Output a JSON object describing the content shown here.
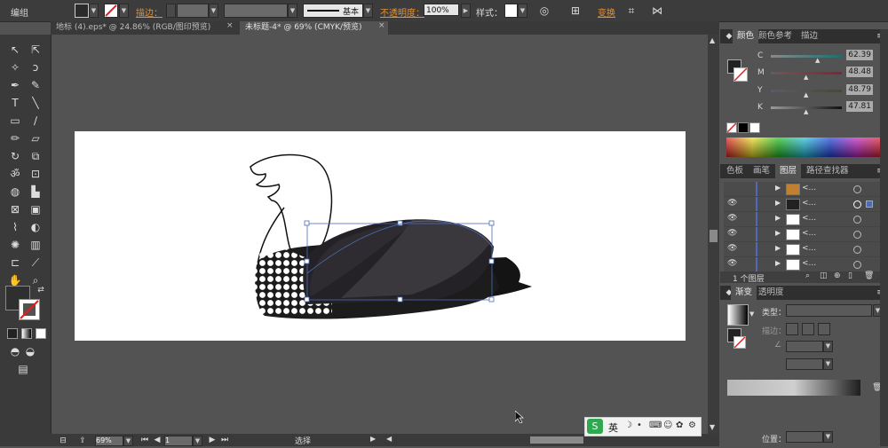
{
  "control_bar": {
    "mode_label": "编组",
    "stroke_label": "描边：",
    "brush_label": "基本",
    "opacity_label": "不透明度：",
    "opacity_value": "100%",
    "style_label": "样式：",
    "transform_label": "变换"
  },
  "tabs": [
    {
      "label": "地标 (4).eps* @ 24.86% (RGB/图印预览)",
      "close": "×"
    },
    {
      "label": "未标题-4* @ 69% (CMYK/预览)",
      "close": "×"
    }
  ],
  "color_panel": {
    "tabs": [
      "颜色",
      "颜色参考",
      "描边"
    ],
    "channels": [
      {
        "name": "C",
        "value": "62.39",
        "pos": 0.62
      },
      {
        "name": "M",
        "value": "48.48",
        "pos": 0.48
      },
      {
        "name": "Y",
        "value": "48.79",
        "pos": 0.49
      },
      {
        "name": "K",
        "value": "47.81",
        "pos": 0.48
      }
    ]
  },
  "layers_panel": {
    "tabs": [
      "色板",
      "画笔",
      "图层",
      "路径查找器"
    ],
    "rows": [
      {
        "name": "<...",
        "eye": ""
      },
      {
        "name": "<...",
        "eye": "👁"
      },
      {
        "name": "<...",
        "eye": "👁"
      },
      {
        "name": "<...",
        "eye": "👁"
      },
      {
        "name": "<...",
        "eye": "👁"
      },
      {
        "name": "<...",
        "eye": "👁"
      }
    ],
    "footer": "1 个图层"
  },
  "gradient_panel": {
    "tabs": [
      "渐变",
      "透明度"
    ],
    "type_label": "类型：",
    "stroke_label": "描边：",
    "position_label": "位置："
  },
  "status_bar": {
    "zoom": "69%",
    "page": "1",
    "mode": "选择"
  },
  "ime": {
    "lang": "英"
  },
  "colors": {
    "ui_dark": "#3c3c3c",
    "ui_mid": "#535353",
    "accent": "#e8902f",
    "selection": "#4d6bb8"
  }
}
